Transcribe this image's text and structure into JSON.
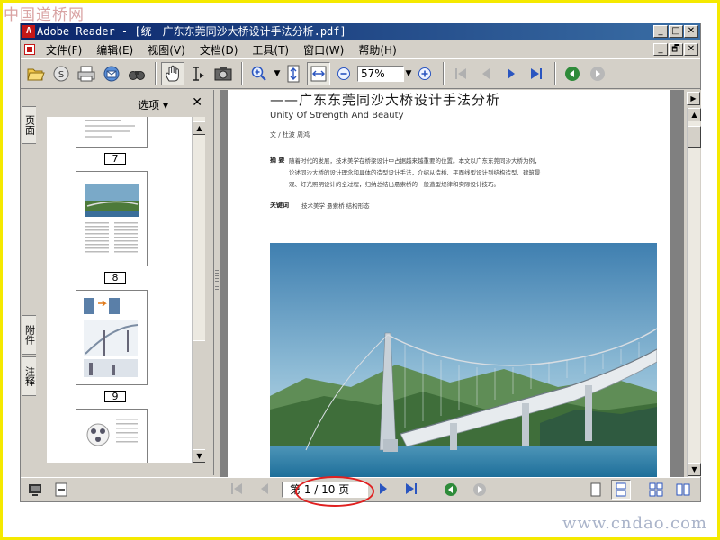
{
  "watermarks": {
    "top": "中国道桥网",
    "bottom": "www.cndao.com"
  },
  "window": {
    "title": "Adobe Reader - [统一广东东莞同沙大桥设计手法分析.pdf]"
  },
  "window_buttons": {
    "minimize": "_",
    "maximize": "□",
    "close": "✕",
    "doc_restore": "🗗"
  },
  "menu": {
    "items": [
      "文件(F)",
      "编辑(E)",
      "视图(V)",
      "文档(D)",
      "工具(T)",
      "窗口(W)",
      "帮助(H)"
    ]
  },
  "toolbar": {
    "zoom_value": "57%",
    "icons": [
      "open-icon",
      "save-icon",
      "print-icon",
      "email-icon",
      "search-icon",
      "hand-tool-icon",
      "select-text-icon",
      "snapshot-icon",
      "zoom-in-icon",
      "fit-height-icon",
      "fit-width-icon",
      "zoom-out-minus-icon",
      "zoom-plus-icon",
      "first-page-icon",
      "prev-page-icon",
      "next-page-icon",
      "last-page-icon",
      "back-icon",
      "forward-icon"
    ]
  },
  "side_tabs": {
    "pages": "页面",
    "attachments": "附件",
    "comments": "注释"
  },
  "nav_panel": {
    "options_label": "选项 ▾",
    "close": "✕"
  },
  "thumbnails": [
    {
      "page": "7"
    },
    {
      "page": "8"
    },
    {
      "page": "9"
    }
  ],
  "document": {
    "headline": "——广东东莞同沙大桥设计手法分析",
    "subtitle": "Unity Of Strength And Beauty",
    "authors": "文 / 杜波   周鸿",
    "abstract_label": "摘 要",
    "abstract_text": "随着时代的发展，技术美学在桥梁设计中占据越来越重要的位置。本文以广东东莞同沙大桥为例，论述同沙大桥的设计理念和具体的造型设计手法，介绍从造桥、平面线型设计到结构造型、建筑景观、灯光照明设计的全过程，归纳总结出悬索桥的一般造型规律和实际设计技巧。",
    "keywords_label": "关键词",
    "keywords_text": "技术美学   悬索桥   结构形态"
  },
  "statusbar": {
    "page_field": "第 1 / 10 页"
  }
}
